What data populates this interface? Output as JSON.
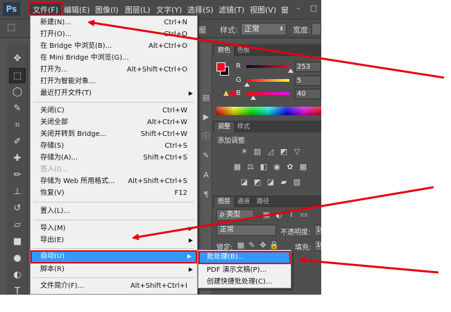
{
  "app": {
    "logo": "Ps"
  },
  "menubar": {
    "items": [
      "文件(F)",
      "编辑(E)",
      "图像(I)",
      "图层(L)",
      "文字(Y)",
      "选择(S)",
      "滤镜(T)",
      "视图(V)",
      "窗"
    ],
    "minimize": "–",
    "restore": "□"
  },
  "options_bar": {
    "feather_partial": "据",
    "style_label": "样式:",
    "style_value": "正常",
    "width_label": "宽度:"
  },
  "file_menu": {
    "items": [
      {
        "label": "新建(N)...",
        "shortcut": "Ctrl+N"
      },
      {
        "label": "打开(O)...",
        "shortcut": "Ctrl+O"
      },
      {
        "label": "在 Bridge 中浏览(B)...",
        "shortcut": "Alt+Ctrl+O"
      },
      {
        "label": "在 Mini Bridge 中浏览(G)...",
        "shortcut": ""
      },
      {
        "label": "打开为...",
        "shortcut": "Alt+Shift+Ctrl+O"
      },
      {
        "label": "打开为智能对象...",
        "shortcut": ""
      },
      {
        "label": "最近打开文件(T)",
        "shortcut": ""
      },
      {
        "label": "关闭(C)",
        "shortcut": "Ctrl+W"
      },
      {
        "label": "关闭全部",
        "shortcut": "Alt+Ctrl+W"
      },
      {
        "label": "关闭并转到 Bridge...",
        "shortcut": "Shift+Ctrl+W"
      },
      {
        "label": "存储(S)",
        "shortcut": "Ctrl+S"
      },
      {
        "label": "存储为(A)...",
        "shortcut": "Shift+Ctrl+S"
      },
      {
        "label": "签入(I)...",
        "shortcut": ""
      },
      {
        "label": "存储为 Web 所用格式...",
        "shortcut": "Alt+Shift+Ctrl+S"
      },
      {
        "label": "恢复(V)",
        "shortcut": "F12"
      },
      {
        "label": "置入(L)...",
        "shortcut": ""
      },
      {
        "label": "导入(M)",
        "shortcut": ""
      },
      {
        "label": "导出(E)",
        "shortcut": ""
      },
      {
        "label": "自动(U)",
        "shortcut": ""
      },
      {
        "label": "脚本(R)",
        "shortcut": ""
      },
      {
        "label": "文件简介(F)...",
        "shortcut": "Alt+Shift+Ctrl+I"
      }
    ]
  },
  "automate_submenu": {
    "items": [
      "批处理(B)...",
      "PDF 演示文稿(P)...",
      "创建快捷批处理(C)..."
    ]
  },
  "panels": {
    "color": {
      "tabs": [
        "颜色",
        "色板"
      ],
      "channels": [
        {
          "label": "R",
          "value": "253"
        },
        {
          "label": "G",
          "value": "5"
        },
        {
          "label": "B",
          "value": "40"
        }
      ]
    },
    "adjustments": {
      "tabs": [
        "调整",
        "样式"
      ],
      "title": "添加调整"
    },
    "layers": {
      "tabs": [
        "图层",
        "通道",
        "路径"
      ],
      "kind_label": "ρ 类型",
      "blend_mode": "正常",
      "opacity_label": "不透明度:",
      "opacity_value": "10",
      "lock_label": "锁定:",
      "fill_label": "填充:",
      "fill_value": "10"
    }
  },
  "colors": {
    "foreground": "#fd0528",
    "annotation": "#e60012",
    "highlight": "#3399ff"
  }
}
